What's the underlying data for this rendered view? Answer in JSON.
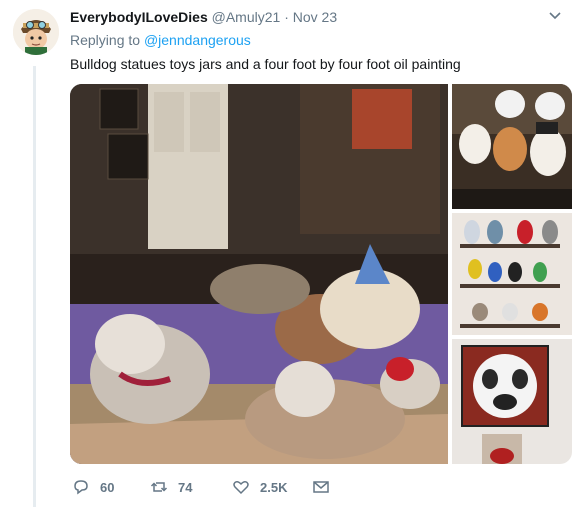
{
  "tweet": {
    "author_name": "EverybodyILoveDies",
    "handle": "@Amuly21",
    "separator": "·",
    "date": "Nov 23",
    "replying_label": "Replying to",
    "replying_handle": "@jenndangerous",
    "text": "Bulldog statues toys jars and a four foot by four foot oil painting"
  },
  "media": {
    "main_photo": "stuffed dogs on bed photo",
    "side_photos": [
      "bulldog cookie jars photo",
      "bulldog figurines shelf photo",
      "bulldog oil painting photo"
    ]
  },
  "actions": {
    "reply": {
      "icon": "reply-icon",
      "count": "60"
    },
    "retweet": {
      "icon": "retweet-icon",
      "count": "74"
    },
    "like": {
      "icon": "heart-icon",
      "count": "2.5K"
    },
    "message": {
      "icon": "envelope-icon"
    }
  },
  "colors": {
    "link": "#1da1f2",
    "secondary_text": "#657786",
    "primary_text": "#14171a"
  }
}
